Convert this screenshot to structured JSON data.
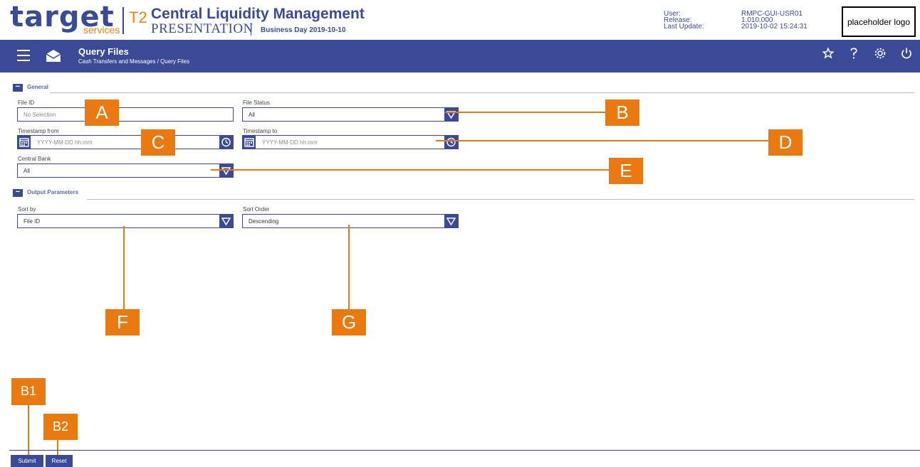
{
  "header": {
    "logo": "target",
    "logo_sub": "services",
    "t2": "T2",
    "app_title": "Central Liquidity Management",
    "environment": "PRESENTATION",
    "business_day": "Business Day 2019-10-10",
    "meta": {
      "user_label": "User:",
      "release_label": "Release:",
      "update_label": "Last Update:",
      "user_value": "RMPC-GUI-USR01",
      "release_value": "1.010.000",
      "update_value": "2019-10-02 15:24:31"
    },
    "placeholder_logo": "placeholder logo"
  },
  "nav": {
    "page_title": "Query Files",
    "breadcrumb": "Cash Transfers and Messages  /  Query Files",
    "icons": [
      "menu-icon",
      "mail-icon",
      "star-icon",
      "help-icon",
      "settings-icon",
      "power-icon"
    ]
  },
  "general": {
    "title": "General",
    "collapse": "−",
    "file_id": {
      "label": "File ID",
      "placeholder": "No Selection"
    },
    "file_status": {
      "label": "File Status",
      "value": "All"
    },
    "timestamp_from": {
      "label": "Timestamp from",
      "placeholder": "YYYY-MM-DD hh:mm"
    },
    "timestamp_to": {
      "label": "Timestamp to",
      "placeholder": "YYYY-MM-DD hh:mm"
    },
    "central_bank": {
      "label": "Central Bank",
      "value": "All"
    }
  },
  "output": {
    "title": "Output Parameters",
    "collapse": "−",
    "sort_by": {
      "label": "Sort by",
      "value": "File ID"
    },
    "sort_order": {
      "label": "Sort Order",
      "value": "Descending"
    }
  },
  "callouts": {
    "A": "A",
    "B": "B",
    "C": "C",
    "D": "D",
    "E": "E",
    "F": "F",
    "G": "G",
    "B1": "B1",
    "B2": "B2"
  },
  "footer": {
    "submit": "Submit",
    "reset": "Reset"
  },
  "colors": {
    "primary": "#3a4a96",
    "accent": "#ea7a10",
    "logo_orange": "#e9850f"
  }
}
